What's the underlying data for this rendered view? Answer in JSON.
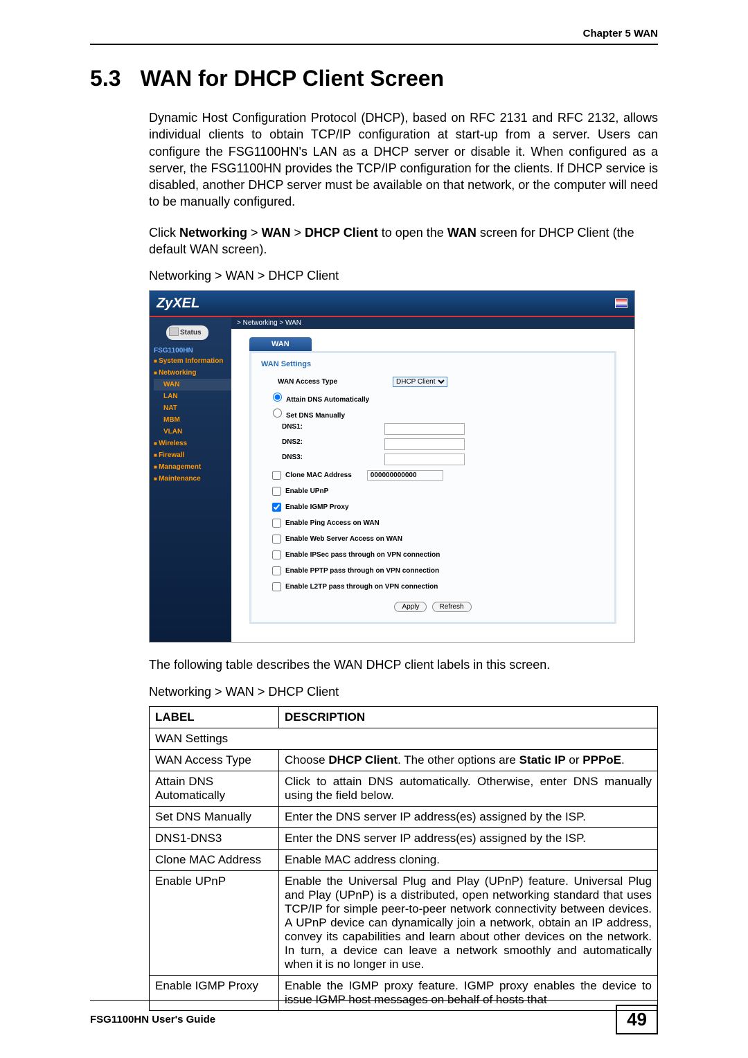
{
  "chapter_header": "Chapter 5 WAN",
  "section_number": "5.3",
  "section_title": "WAN for DHCP Client Screen",
  "paragraph1": "Dynamic Host Configuration Protocol (DHCP), based on RFC 2131 and RFC 2132, allows individual clients to obtain TCP/IP configuration at start-up from a server. Users can configure the FSG1100HN's LAN as a DHCP server or disable it. When configured as a server, the FSG1100HN provides the TCP/IP configuration for the clients. If DHCP service is disabled, another DHCP server must be available on that network, or the computer will need to be manually configured.",
  "paragraph2_pre": "Click ",
  "paragraph2_b1": "Networking",
  "paragraph2_sep": " > ",
  "paragraph2_b2": "WAN",
  "paragraph2_b3": "DHCP Client",
  "paragraph2_mid": " to open the ",
  "paragraph2_b4": "WAN",
  "paragraph2_post": " screen for DHCP Client (the default WAN screen).",
  "figure_caption": "Networking > WAN > DHCP Client",
  "screenshot": {
    "logo": "ZyXEL",
    "status_btn": "Status",
    "device_model": "FSG1100HN",
    "sys_info": "System Information",
    "nav": {
      "networking": "Networking",
      "wan": "WAN",
      "lan": "LAN",
      "nat": "NAT",
      "mbm": "MBM",
      "vlan": "VLAN",
      "wireless": "Wireless",
      "firewall": "Firewall",
      "management": "Management",
      "maintenance": "Maintenance"
    },
    "crumb": "> Networking > WAN",
    "tab": "WAN",
    "panel_title": "WAN Settings",
    "access_type_label": "WAN Access Type",
    "access_type_value": "DHCP Client",
    "radio_attain": "Attain DNS Automatically",
    "radio_manual": "Set DNS Manually",
    "dns1": "DNS1:",
    "dns2": "DNS2:",
    "dns3": "DNS3:",
    "clone_mac": "Clone MAC Address",
    "clone_mac_val": "000000000000",
    "upnp": "Enable UPnP",
    "igmp": "Enable IGMP Proxy",
    "ping": "Enable Ping Access on WAN",
    "webserver": "Enable Web Server Access on WAN",
    "ipsec": "Enable IPSec pass through on VPN connection",
    "pptp": "Enable PPTP pass through on VPN connection",
    "l2tp": "Enable L2TP pass through on VPN connection",
    "btn_apply": "Apply",
    "btn_refresh": "Refresh"
  },
  "post_fig_text": "The following table describes the WAN DHCP client labels in this screen.",
  "table_caption": "Networking > WAN > DHCP Client",
  "table": {
    "h_label": "LABEL",
    "h_desc": "DESCRIPTION",
    "r_wansettings": "WAN Settings",
    "r_access_l": "WAN Access Type",
    "r_access_d_pre": "Choose ",
    "r_access_d_b1": "DHCP Client",
    "r_access_d_mid": ". The other options are ",
    "r_access_d_b2": "Static IP",
    "r_access_d_or": " or ",
    "r_access_d_b3": "PPPoE",
    "r_access_d_post": ".",
    "r_attain_l": "Attain DNS Automatically",
    "r_attain_d": "Click to attain DNS automatically. Otherwise, enter DNS manually using the field below.",
    "r_setdns_l": "Set DNS Manually",
    "r_setdns_d": "Enter the DNS server IP address(es) assigned by the ISP.",
    "r_dns13_l": "DNS1-DNS3",
    "r_dns13_d": "Enter the DNS server IP address(es) assigned by the ISP.",
    "r_clone_l": "Clone MAC Address",
    "r_clone_d": "Enable MAC address cloning.",
    "r_upnp_l": "Enable UPnP",
    "r_upnp_d": "Enable the Universal Plug and Play (UPnP) feature. Universal Plug and Play (UPnP) is a distributed, open networking standard that uses TCP/IP for simple peer-to-peer network connectivity between devices. A UPnP device can dynamically join a network, obtain an IP address, convey its capabilities and learn about other devices on the network. In turn, a device can leave a network smoothly and automatically when it is no longer in use.",
    "r_igmp_l": "Enable IGMP Proxy",
    "r_igmp_d": "Enable the IGMP proxy feature. IGMP proxy enables the device to issue IGMP host messages on behalf of hosts that"
  },
  "footer_guide": "FSG1100HN User's Guide",
  "footer_page": "49"
}
